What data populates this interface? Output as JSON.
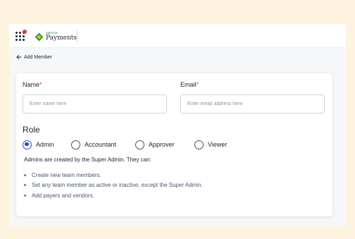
{
  "app": {
    "company": "ZWITCH",
    "product": "Payments",
    "apps_icon": "grid-apps-icon",
    "colors": {
      "page_background": "#fdf3df",
      "accent": "#1e4bd6",
      "required": "#e53935",
      "brand_green": "#2e9e4b"
    }
  },
  "breadcrumb": {
    "back_icon": "arrow-left-icon",
    "label": "Add Member"
  },
  "form": {
    "name": {
      "label": "Name",
      "required_mark": "*",
      "value": "",
      "placeholder": "Enter name here"
    },
    "email": {
      "label": "Email",
      "required_mark": "*",
      "value": "",
      "placeholder": "Enter email address here"
    },
    "role": {
      "title": "Role",
      "options": [
        {
          "label": "Admin",
          "selected": true
        },
        {
          "label": "Accountant",
          "selected": false
        },
        {
          "label": "Approver",
          "selected": false
        },
        {
          "label": "Viewer",
          "selected": false
        }
      ],
      "description": "Admins are created by the Super Admin. They can:",
      "permissions": [
        "Create new team members.",
        "Set any team member as active or inactive, except the Super Admin.",
        "Add payers and vendors."
      ]
    }
  }
}
